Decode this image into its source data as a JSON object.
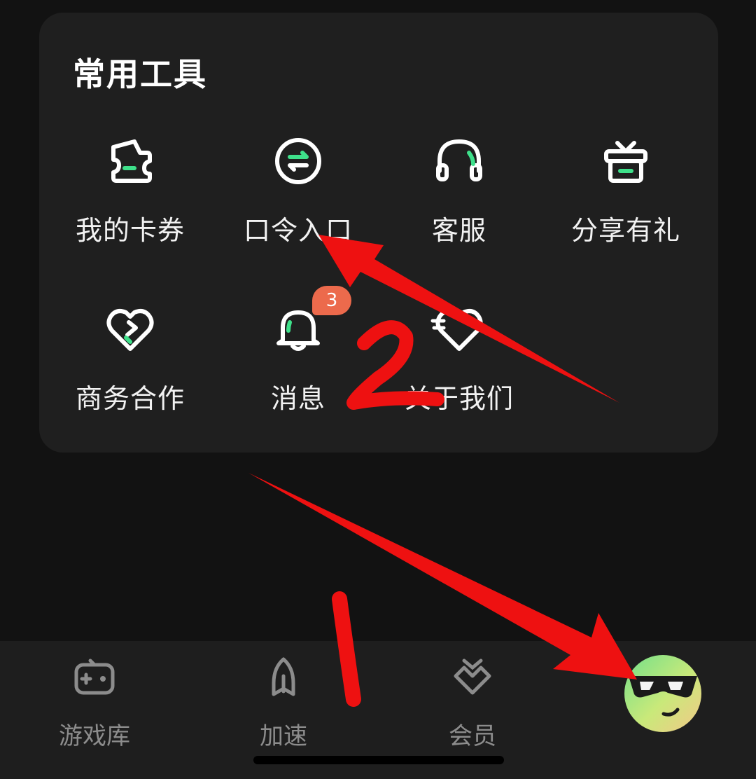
{
  "tools": {
    "title": "常用工具",
    "items": [
      {
        "label": "我的卡券",
        "icon": "coupon-icon"
      },
      {
        "label": "口令入口",
        "icon": "exchange-icon"
      },
      {
        "label": "客服",
        "icon": "headset-icon"
      },
      {
        "label": "分享有礼",
        "icon": "gift-icon"
      },
      {
        "label": "商务合作",
        "icon": "heart-handshake-icon"
      },
      {
        "label": "消息",
        "icon": "bell-icon",
        "badge": "3"
      },
      {
        "label": "关于我们",
        "icon": "about-icon"
      }
    ]
  },
  "tabbar": {
    "items": [
      {
        "label": "游戏库",
        "icon": "gamepad-icon"
      },
      {
        "label": "加速",
        "icon": "rocket-icon"
      },
      {
        "label": "会员",
        "icon": "vip-icon"
      },
      {
        "label": "",
        "icon": "avatar-icon"
      }
    ]
  },
  "annotations": {
    "step1": "1",
    "step2": "2"
  },
  "colors": {
    "accent": "#3ee08a",
    "badge": "#ec6a4c",
    "annotation": "#ee1111"
  }
}
